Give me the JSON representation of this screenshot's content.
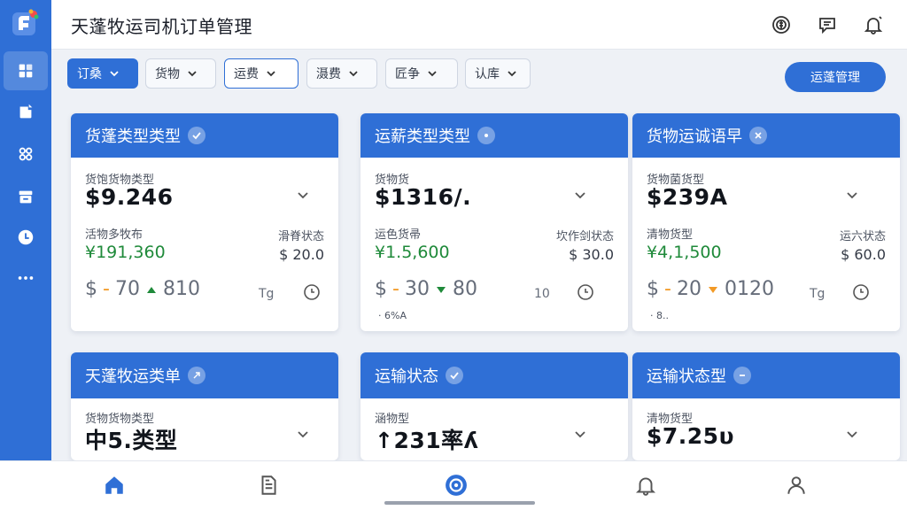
{
  "app": {
    "title": "天蓬牧运司机订单管理",
    "accent_color": "#2f6fd6"
  },
  "sidebar": {
    "items": [
      {
        "icon": "dashboard-icon",
        "active": true
      },
      {
        "icon": "document-chart-icon"
      },
      {
        "icon": "apps-icon"
      },
      {
        "icon": "archive-icon"
      },
      {
        "icon": "clock-icon"
      },
      {
        "icon": "more-icon"
      }
    ]
  },
  "header": {
    "icons": [
      "currency-icon",
      "message-icon",
      "notification-icon"
    ]
  },
  "filters": {
    "chips": [
      {
        "label": "订桑"
      },
      {
        "label": "货物"
      },
      {
        "label": "运费"
      },
      {
        "label": "滠费"
      },
      {
        "label": "匠争"
      },
      {
        "label": "认库"
      }
    ],
    "manage_label": "运蓬管理"
  },
  "cards": [
    {
      "title": "货蓬类型类型",
      "top_label": "货饱货物类型",
      "big_value": "$9.246",
      "mid_label": "活物多牧布",
      "green_value": "¥191,360",
      "status_label": "滑脊状态",
      "status_value": "$  20.0",
      "metric_left": "$",
      "metric_a": "70",
      "metric_b": "810",
      "unit": "Tg"
    },
    {
      "title": "运薪类型类型",
      "top_label": "货物货",
      "big_value": "$1316/.",
      "mid_label": "运色货帚",
      "green_value": "¥1.5,600",
      "status_label": "坎作剑状态",
      "status_value": "$  30.0",
      "metric_left": "$",
      "metric_a": "30",
      "metric_b": "80",
      "unit": "10",
      "note": "· 6%A"
    },
    {
      "title": "货物运诚语早",
      "top_label": "货物菌货型",
      "big_value": "$239A",
      "mid_label": "清物货型",
      "green_value": "¥4,1,500",
      "status_label": "运六状态",
      "status_value": "$  60.0",
      "metric_left": "$",
      "metric_a": "20",
      "metric_b": "0120",
      "unit": "Tg",
      "note": "· 8.."
    },
    {
      "title": "天蓬牧运类单",
      "top_label": "货物货物类型",
      "big_value": "中5.类型"
    },
    {
      "title": "运输状态",
      "top_label": "涵物型",
      "big_value": "↑231率ʎ"
    },
    {
      "title": "运输状态型",
      "top_label": "清物货型",
      "big_value": "$7.25υ"
    }
  ],
  "bottom_nav": {
    "items": [
      "home-icon",
      "document-icon",
      "center-action-icon",
      "bell-icon",
      "profile-icon"
    ]
  }
}
